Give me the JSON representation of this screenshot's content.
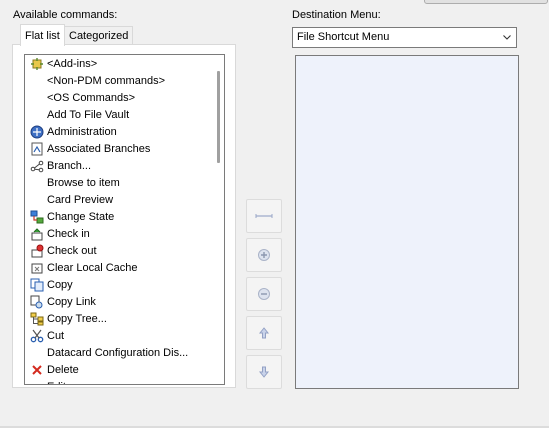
{
  "left_panel": {
    "label": "Available commands:",
    "tabs": [
      {
        "label": "Flat list",
        "active": true
      },
      {
        "label": "Categorized",
        "active": false
      }
    ],
    "commands": [
      {
        "label": "<Add-ins>",
        "icon": "add-ins-icon"
      },
      {
        "label": "<Non-PDM commands>",
        "icon": ""
      },
      {
        "label": "<OS Commands>",
        "icon": ""
      },
      {
        "label": "Add To File Vault",
        "icon": ""
      },
      {
        "label": "Administration",
        "icon": "administration-icon"
      },
      {
        "label": "Associated Branches",
        "icon": "associated-branches-icon"
      },
      {
        "label": "Branch...",
        "icon": "branch-icon"
      },
      {
        "label": "Browse to item",
        "icon": ""
      },
      {
        "label": "Card Preview",
        "icon": ""
      },
      {
        "label": "Change State",
        "icon": "change-state-icon"
      },
      {
        "label": "Check in",
        "icon": "check-in-icon"
      },
      {
        "label": "Check out",
        "icon": "check-out-icon"
      },
      {
        "label": "Clear Local Cache",
        "icon": "clear-cache-icon"
      },
      {
        "label": "Copy",
        "icon": "copy-icon"
      },
      {
        "label": "Copy Link",
        "icon": "copy-link-icon"
      },
      {
        "label": "Copy Tree...",
        "icon": "copy-tree-icon"
      },
      {
        "label": "Cut",
        "icon": "scissors-icon"
      },
      {
        "label": "Datacard Configuration Dis...",
        "icon": ""
      },
      {
        "label": "Delete",
        "icon": "delete-x-icon"
      },
      {
        "label": "Edit...",
        "icon": ""
      }
    ]
  },
  "side_buttons": [
    {
      "name": "separator-button",
      "icon": "separator-line-icon"
    },
    {
      "name": "add-button",
      "icon": "plus-circle-icon"
    },
    {
      "name": "remove-button",
      "icon": "minus-circle-icon"
    },
    {
      "name": "move-up-button",
      "icon": "arrow-up-icon"
    },
    {
      "name": "move-down-button",
      "icon": "arrow-down-icon"
    }
  ],
  "right_panel": {
    "label": "Destination Menu:",
    "selected_menu": "File Shortcut Menu",
    "items": []
  },
  "colors": {
    "window_bg": "#f0f0f0",
    "list_bg": "#ffffff",
    "destination_bg": "#eef2fb",
    "border": "#7a7a7a"
  }
}
